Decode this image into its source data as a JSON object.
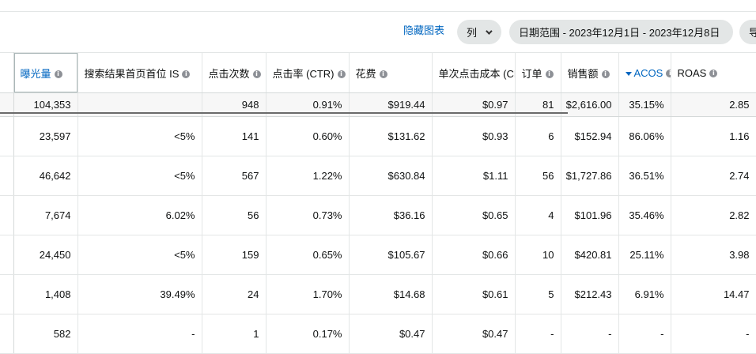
{
  "toolbar": {
    "hide_chart": "隐藏图表",
    "columns": "列",
    "date_range": "日期范围 - 2023年12月1日 - 2023年12月8日",
    "export": "导"
  },
  "columns": [
    {
      "label": "曝光量",
      "info": "i"
    },
    {
      "label": "搜索结果首页首位 IS",
      "info": "i"
    },
    {
      "label": "点击次数",
      "info": "i"
    },
    {
      "label": "点击率 (CTR)",
      "info": "i"
    },
    {
      "label": "花费",
      "info": "i"
    },
    {
      "label": "单次点击成本 (CPC)",
      "info": ""
    },
    {
      "label": "订单",
      "info": "i"
    },
    {
      "label": "销售额",
      "info": "i"
    },
    {
      "label": "ACOS",
      "info": "i",
      "sorted": "desc"
    },
    {
      "label": "ROAS",
      "info": "i"
    }
  ],
  "totals": [
    "104,353",
    "",
    "948",
    "0.91%",
    "$919.44",
    "$0.97",
    "81",
    "$2,616.00",
    "35.15%",
    "2.85"
  ],
  "rows": [
    [
      "23,597",
      "<5%",
      "141",
      "0.60%",
      "$131.62",
      "$0.93",
      "6",
      "$152.94",
      "86.06%",
      "1.16"
    ],
    [
      "46,642",
      "<5%",
      "567",
      "1.22%",
      "$630.84",
      "$1.11",
      "56",
      "$1,727.86",
      "36.51%",
      "2.74"
    ],
    [
      "7,674",
      "6.02%",
      "56",
      "0.73%",
      "$36.16",
      "$0.65",
      "4",
      "$101.96",
      "35.46%",
      "2.82"
    ],
    [
      "24,450",
      "<5%",
      "159",
      "0.65%",
      "$105.67",
      "$0.66",
      "10",
      "$420.81",
      "25.11%",
      "3.98"
    ],
    [
      "1,408",
      "39.49%",
      "24",
      "1.70%",
      "$14.68",
      "$0.61",
      "5",
      "$212.43",
      "6.91%",
      "14.47"
    ],
    [
      "582",
      "-",
      "1",
      "0.17%",
      "$0.47",
      "$0.47",
      "-",
      "-",
      "-",
      "-"
    ]
  ],
  "accent": "#0066c0"
}
